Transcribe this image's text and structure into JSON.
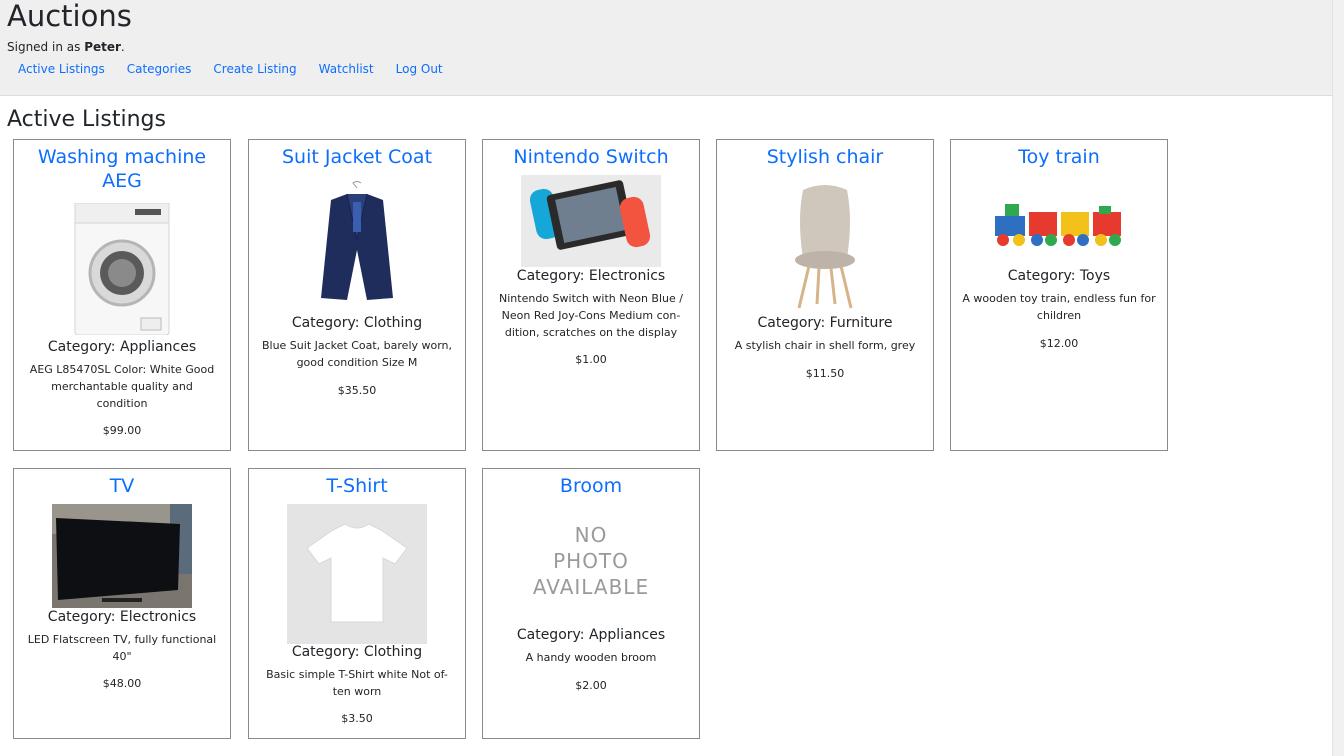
{
  "header": {
    "title": "Auctions",
    "signed_in_prefix": "Signed in as",
    "username": "Peter",
    "signed_in_suffix": "."
  },
  "nav": {
    "items": [
      {
        "label": "Active Listings"
      },
      {
        "label": "Categories"
      },
      {
        "label": "Create Listing"
      },
      {
        "label": "Watchlist"
      },
      {
        "label": "Log Out"
      }
    ]
  },
  "main": {
    "heading": "Active Listings",
    "listings": [
      {
        "title": "Washing machine AEG",
        "category": "Category: Appliances",
        "description": "AEG L85470SL Color: White Good merchantable quality and condition",
        "price": "$99.00"
      },
      {
        "title": "Suit Jacket Coat",
        "category": "Category: Clothing",
        "description": "Blue Suit Jacket Coat, barely worn, good condition Size M",
        "price": "$35.50"
      },
      {
        "title": "Nintendo Switch",
        "category": "Category: Electronics",
        "description": "Nintendo Switch with Neon Blue / Neon Red Joy-Cons Medium con-dition, scratches on the display",
        "price": "$1.00"
      },
      {
        "title": "Stylish chair",
        "category": "Category: Furniture",
        "description": "A stylish chair in shell form, grey",
        "price": "$11.50"
      },
      {
        "title": "Toy train",
        "category": "Category: Toys",
        "description": "A wooden toy train, endless fun for children",
        "price": "$12.00"
      },
      {
        "title": "TV",
        "category": "Category: Electronics",
        "description": "LED Flatscreen TV, fully functional 40\"",
        "price": "$48.00"
      },
      {
        "title": "T-Shirt",
        "category": "Category: Clothing",
        "description": "Basic simple T-Shirt white Not of-ten worn",
        "price": "$3.50"
      },
      {
        "title": "Broom",
        "category": "Category: Appliances",
        "description": "A handy wooden broom",
        "price": "$2.00",
        "no_photo": [
          "NO",
          "PHOTO",
          "AVAILABLE"
        ]
      }
    ]
  }
}
